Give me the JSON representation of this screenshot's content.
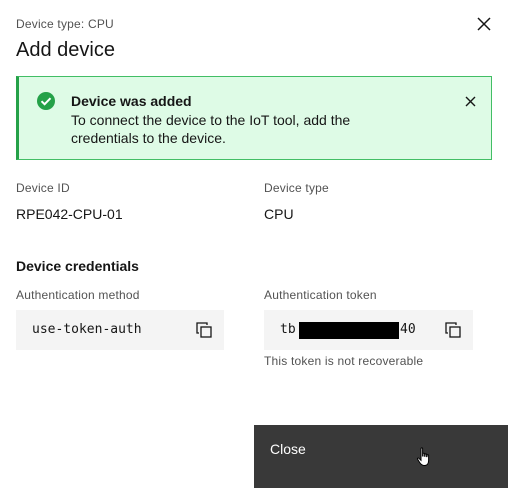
{
  "modal": {
    "eyebrow": "Device type: CPU",
    "title": "Add device",
    "close_icon": "close-icon"
  },
  "notification": {
    "status": "success",
    "icon": "checkmark-filled-icon",
    "title": "Device was added",
    "body": "To connect the device to the IoT tool, add the credentials to the device.",
    "close_icon": "close-icon"
  },
  "device": {
    "id_label": "Device ID",
    "id_value": "RPE042-CPU-01",
    "type_label": "Device type",
    "type_value": "CPU"
  },
  "credentials": {
    "heading": "Device credentials",
    "auth_method_label": "Authentication method",
    "auth_method_value": "use-token-auth",
    "auth_token_label": "Authentication token",
    "auth_token_prefix": "tb",
    "auth_token_suffix": "40",
    "auth_token_redacted": true,
    "auth_token_helper": "This token is not recoverable",
    "copy_icon": "copy-icon"
  },
  "footer": {
    "primary_label": "Close"
  },
  "colors": {
    "success_bg": "#defbe6",
    "success_border": "#24a148",
    "button_bg": "#393939",
    "snippet_bg": "#f4f4f4"
  }
}
